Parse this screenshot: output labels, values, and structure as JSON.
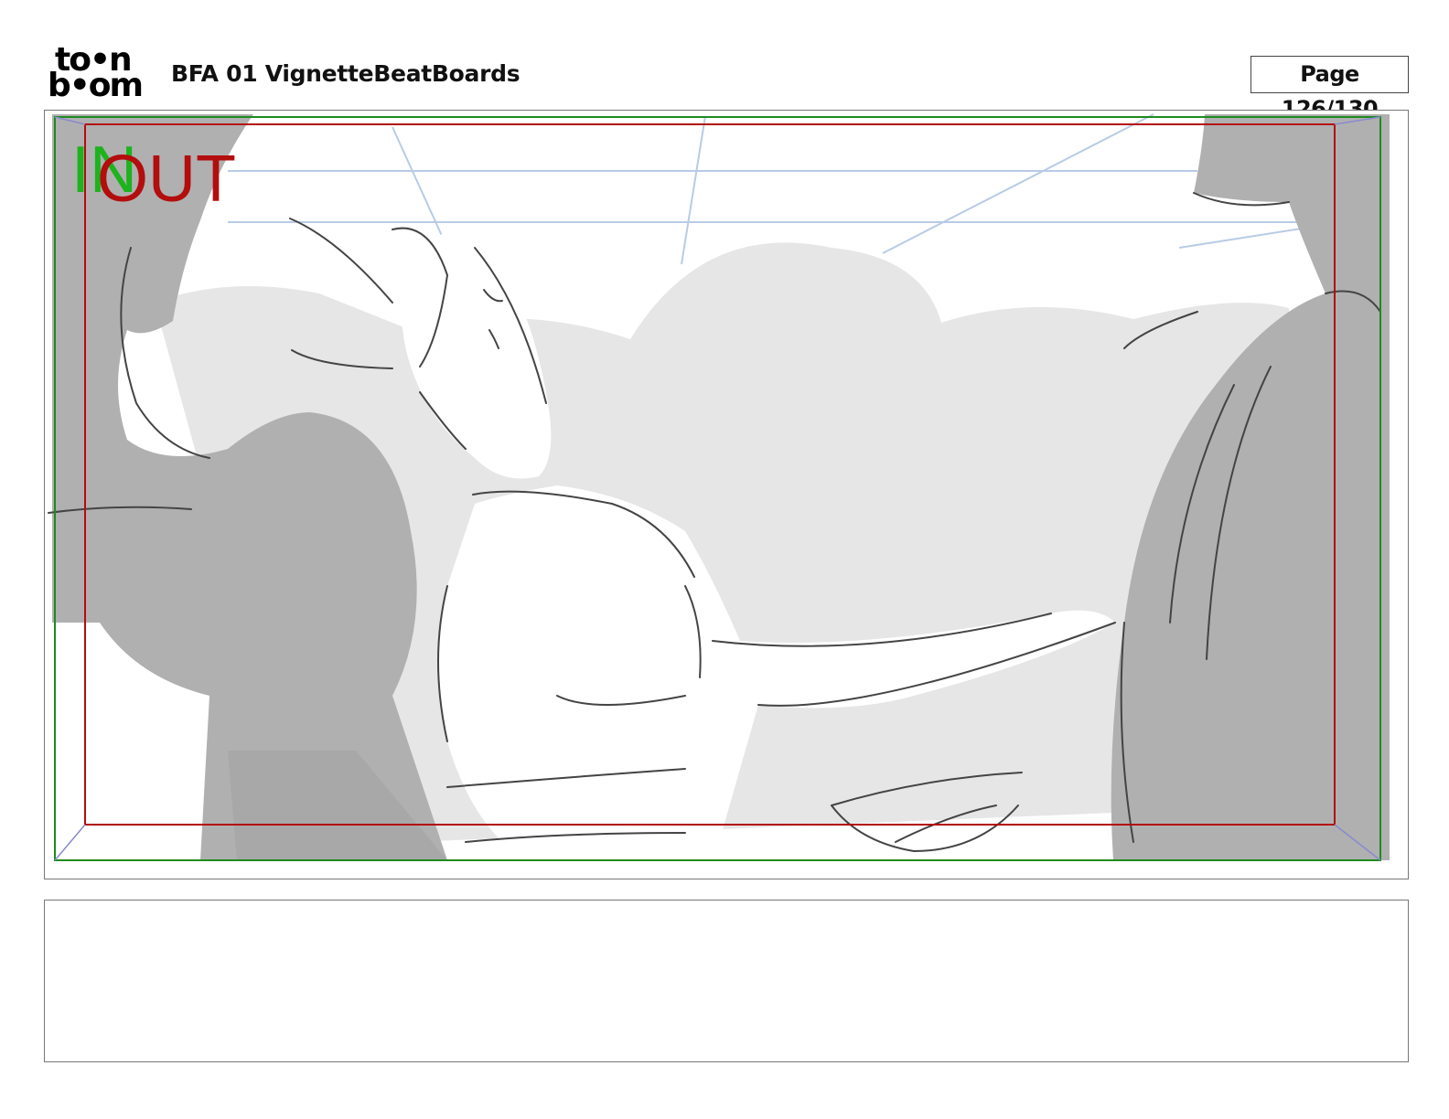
{
  "header": {
    "logo_line1": "to•n",
    "logo_line2": "b•om",
    "title": "BFA 01 VignetteBeatBoards",
    "page_label": "Page 126/130"
  },
  "panel": {
    "in_label": "IN",
    "out_label": "OUT",
    "colors": {
      "in_frame": "#1f8a1f",
      "out_frame": "#b30d0d",
      "shadow": "#b0b0b0",
      "midtone": "#e6e6e6",
      "sky_lines": "#b8cbe6",
      "corner_marks": "#8a8ad0"
    }
  },
  "notes": {
    "text": ""
  }
}
